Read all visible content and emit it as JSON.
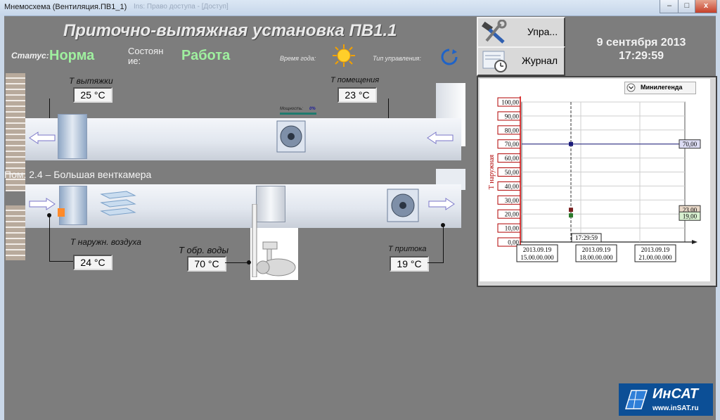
{
  "window": {
    "title": "Мнемосхема (Вентиляция.ПВ1_1)",
    "ghost_title": "Ins: Право доступа - [Доступ]",
    "minimize": "–",
    "maximize": "□",
    "close": "x"
  },
  "header": {
    "title": "Приточно-вытяжная установка ПВ1.1",
    "status_label": "Статус:",
    "status_value": "Норма",
    "state_label": "Состоян\nие:",
    "state_value": "Работа",
    "season_label": "Время года:",
    "control_label": "Тип управления:"
  },
  "controls": {
    "manage_label": "Упра...",
    "journal_label": "Журнал"
  },
  "datetime": {
    "date": "9 сентября 2013",
    "time": "17:29:59"
  },
  "scheme": {
    "room_caption": "Пом. 2.4 – Большая венткамера",
    "fan_power_label": "Мощность:",
    "fan_power_value": "0%",
    "fan_power_fraction": 0.0,
    "t_exhaust_label": "Т вытяжки",
    "t_exhaust_value": "25 °C",
    "t_room_label": "Т помещения",
    "t_room_value": "23 °C",
    "t_outdoor_label": "Т наружн. воздуха",
    "t_outdoor_value": "24 °C",
    "t_water_label": "Т обр. воды",
    "t_water_value": "70 °C",
    "t_supply_label": "Т притока",
    "t_supply_value": "19 °C"
  },
  "chart_data": {
    "type": "line",
    "legend_button": "Минилегенда",
    "ylabel": "Т наружная",
    "ylim": [
      0,
      100
    ],
    "y_ticks": [
      "100,00",
      "90,00",
      "80,00",
      "70,00",
      "60,00",
      "50,00",
      "40,00",
      "30,00",
      "20,00",
      "10,00",
      "0,00"
    ],
    "x_ticks": [
      {
        "date": "2013.09.19",
        "time": "15.00.00.000"
      },
      {
        "date": "2013.09.19",
        "time": "18.00.00.000"
      },
      {
        "date": "2013.09.19",
        "time": "21.00.00.000"
      }
    ],
    "cursor_time": "17:29:59",
    "series": [
      {
        "value": 70.0,
        "color": "#1a1a7a"
      },
      {
        "value": 23.0,
        "color": "#7a2020"
      },
      {
        "value": 19.0,
        "color": "#2b7a2b"
      }
    ],
    "right_labels": [
      "70,00",
      "23,00",
      "19,00"
    ]
  },
  "logo": {
    "name": "ИнСАТ",
    "url_text": "www.inSAT.ru"
  }
}
